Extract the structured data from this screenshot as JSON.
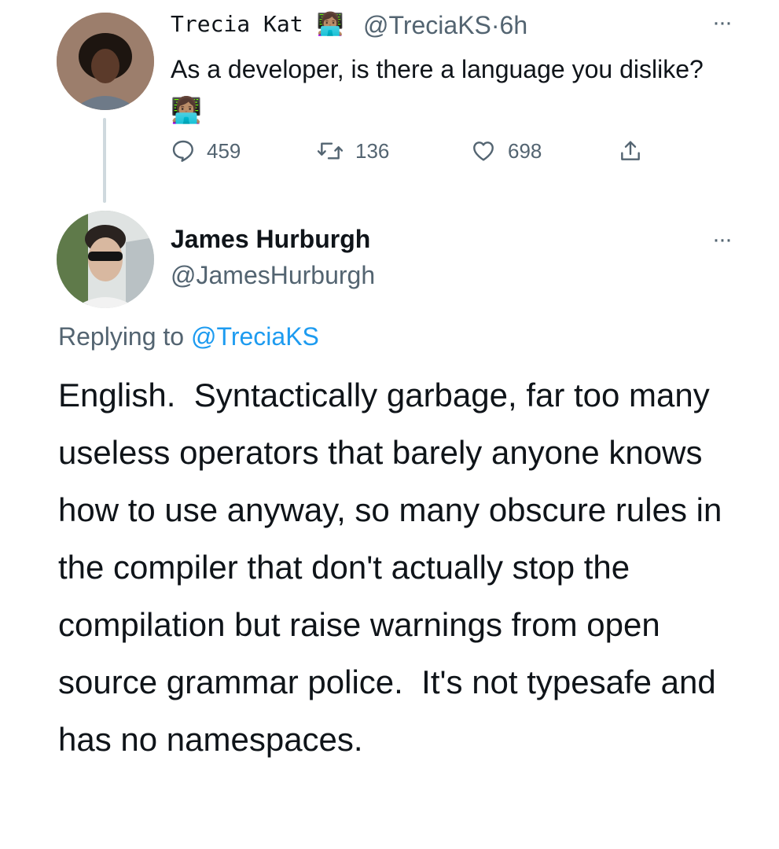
{
  "original_tweet": {
    "author_name": "Trecia Kat",
    "author_emoji": "👩🏽‍💻",
    "handle": "@TreciaKS",
    "separator": "·",
    "time": "6h",
    "text": "As a developer, is there a language you dislike?",
    "text_emoji": "👩🏽‍💻",
    "more_label": "···",
    "replies": "459",
    "retweets": "136",
    "likes": "698",
    "icons": {
      "reply": "reply-icon",
      "retweet": "retweet-icon",
      "like": "heart-icon",
      "share": "share-icon"
    }
  },
  "reply_tweet": {
    "author_name": "James Hurburgh",
    "handle": "@JamesHurburgh",
    "more_label": "···",
    "replying_prefix": "Replying to",
    "replying_to": "@TreciaKS",
    "text": "English.  Syntactically garbage, far too many useless operators that barely anyone knows how to use anyway, so many obscure rules in the compiler that don't actually stop the compilation but raise warnings from open source grammar police.  It's not typesafe and has no namespaces."
  },
  "colors": {
    "text": "#0f1419",
    "secondary": "#536471",
    "link": "#1d9bf0",
    "thread_line": "#cfd9de"
  }
}
